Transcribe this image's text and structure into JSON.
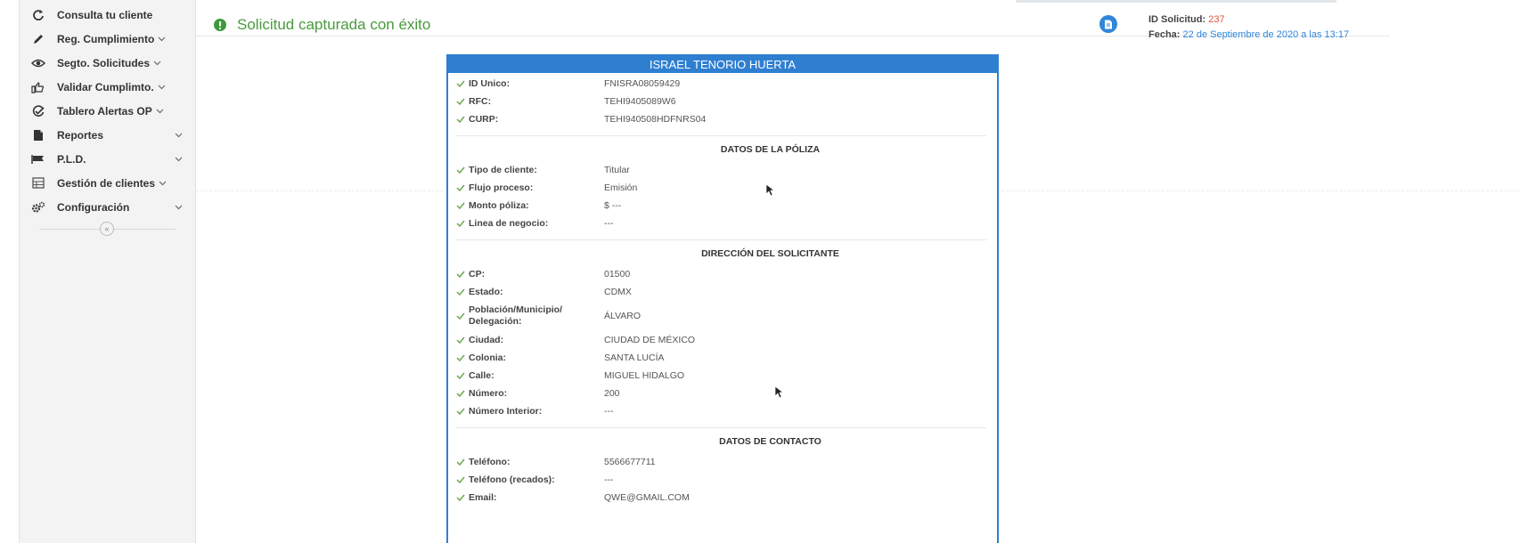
{
  "sidebar": {
    "items": [
      {
        "label": "Consulta tu cliente",
        "icon": "refresh-icon",
        "chevron": false
      },
      {
        "label": "Reg. Cumplimiento",
        "icon": "pencil-icon",
        "chevron": true
      },
      {
        "label": "Segto. Solicitudes",
        "icon": "eye-icon",
        "chevron": true
      },
      {
        "label": "Validar Cumplimto.",
        "icon": "hand-icon",
        "chevron": true
      },
      {
        "label": "Tablero Alertas OP",
        "icon": "check-circle-icon",
        "chevron": true
      },
      {
        "label": "Reportes",
        "icon": "document-icon",
        "chevron": true
      },
      {
        "label": "P.L.D.",
        "icon": "flag-icon",
        "chevron": true
      },
      {
        "label": "Gestión de clientes",
        "icon": "table-icon",
        "chevron": true
      },
      {
        "label": "Configuración",
        "icon": "gears-icon",
        "chevron": true
      }
    ],
    "collapse_glyph": "«"
  },
  "header": {
    "success_message": "Solicitud capturada con éxito",
    "id_label": "ID Solicitud:",
    "id_value": "237",
    "date_label": "Fecha:",
    "date_value": "22 de Septiembre de 2020 a las 13:17"
  },
  "card": {
    "title": "ISRAEL TENORIO HUERTA",
    "identity": [
      {
        "label": "ID Unico:",
        "value": "FNISRA08059429"
      },
      {
        "label": "RFC:",
        "value": "TEHI9405089W6"
      },
      {
        "label": "CURP:",
        "value": "TEHI940508HDFNRS04"
      }
    ],
    "sections": [
      {
        "title": "DATOS DE LA PÓLIZA",
        "rows": [
          {
            "label": "Tipo de cliente:",
            "value": "Titular"
          },
          {
            "label": "Flujo proceso:",
            "value": "Emisión"
          },
          {
            "label": "Monto póliza:",
            "value": "$ ---"
          },
          {
            "label": "Linea de negocio:",
            "value": "---"
          }
        ]
      },
      {
        "title": "DIRECCIÓN DEL SOLICITANTE",
        "rows": [
          {
            "label": "CP:",
            "value": "01500"
          },
          {
            "label": "Estado:",
            "value": "CDMX"
          },
          {
            "label": "Población/Municipio/ Delegación:",
            "value": "ÁLVARO"
          },
          {
            "label": "Ciudad:",
            "value": "CIUDAD DE MÉXICO"
          },
          {
            "label": "Colonia:",
            "value": "SANTA LUCÍA"
          },
          {
            "label": "Calle:",
            "value": "MIGUEL HIDALGO"
          },
          {
            "label": "Número:",
            "value": "200"
          },
          {
            "label": "Número Interior:",
            "value": "---"
          }
        ]
      },
      {
        "title": "DATOS DE CONTACTO",
        "rows": [
          {
            "label": "Teléfono:",
            "value": "5566677711"
          },
          {
            "label": "Teléfono (recados):",
            "value": "---"
          },
          {
            "label": "Email:",
            "value": "QWE@GMAIL.COM"
          }
        ]
      }
    ]
  },
  "colors": {
    "accent_blue": "#2f7fd1",
    "success_green": "#4a9a3e",
    "id_red": "#e2543f",
    "check_green": "#6aa84f"
  }
}
